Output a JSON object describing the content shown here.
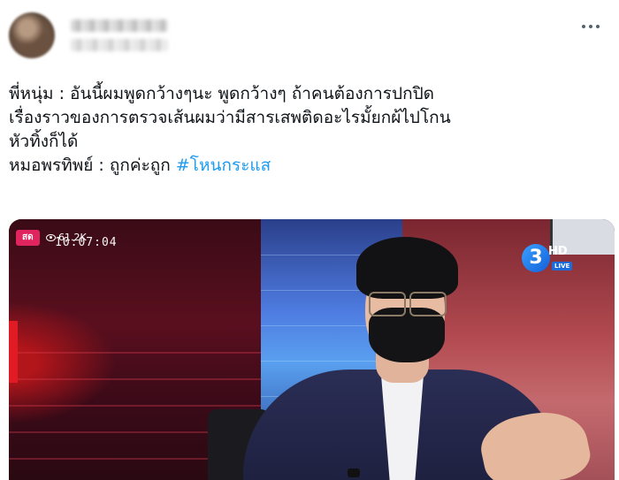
{
  "tweet": {
    "lines": [
      "พี่หนุ่ม : อันนี้ผมพูดกว้างๆนะ พูดกว้างๆ ถ้าคนต้องการปกปิด",
      "เรื่องราวของการตรวจเส้นผมว่ามีสารเสพติดอะไรมั้ยกผ้ไปโกน",
      "หัวทิ้งก็ได้",
      "หมอพรทิพย์ : ถูกค่ะถูก"
    ],
    "hashtag": "#โหนกระแส"
  },
  "video": {
    "live_label": "สด",
    "viewers": "61.2K",
    "clock": "10:07:04",
    "channel": {
      "number": "3",
      "hd": "HD",
      "live": "LIVE"
    }
  },
  "icons": {
    "more": "more-horizontal-icon",
    "eye": "eye-icon"
  },
  "colors": {
    "hashtag": "#1d9bf0",
    "live_badge": "#e0245e"
  }
}
